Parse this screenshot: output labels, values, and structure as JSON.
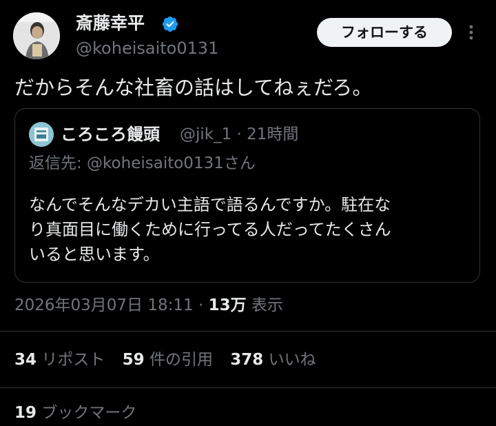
{
  "author": {
    "display_name": "斎藤幸平",
    "handle": "@koheisaito0131",
    "verified_icon": "verified-badge-icon"
  },
  "follow_button_label": "フォローする",
  "tweet_text": "だからそんな社畜の話はしてねぇだろ。",
  "quote": {
    "display_name": "ころころ饅頭",
    "handle_time": "@jik_1 · 21時間",
    "reply_to": "返信先: @koheisaito0131さん",
    "text_lines": [
      "なんでそんなデカい主語で語るんですか。駐在な",
      "り真面目に働くために行ってる人だってたくさん",
      "いると思います。"
    ]
  },
  "meta": {
    "timestamp": "2026年03月07日 18:11 · ",
    "views_count": "13万",
    "views_label": " 表示"
  },
  "stats": {
    "reposts": {
      "count": "34",
      "label": " リポスト"
    },
    "quotes": {
      "count": "59",
      "label": " 件の引用"
    },
    "likes": {
      "count": "378",
      "label": " いいね"
    },
    "bookmarks": {
      "count": "19",
      "label": " ブックマーク"
    }
  },
  "colors": {
    "background": "#000000",
    "text_primary": "#e7e9ea",
    "text_secondary": "#71767b",
    "verified_blue": "#1d9bf0",
    "border": "#2f3336"
  }
}
